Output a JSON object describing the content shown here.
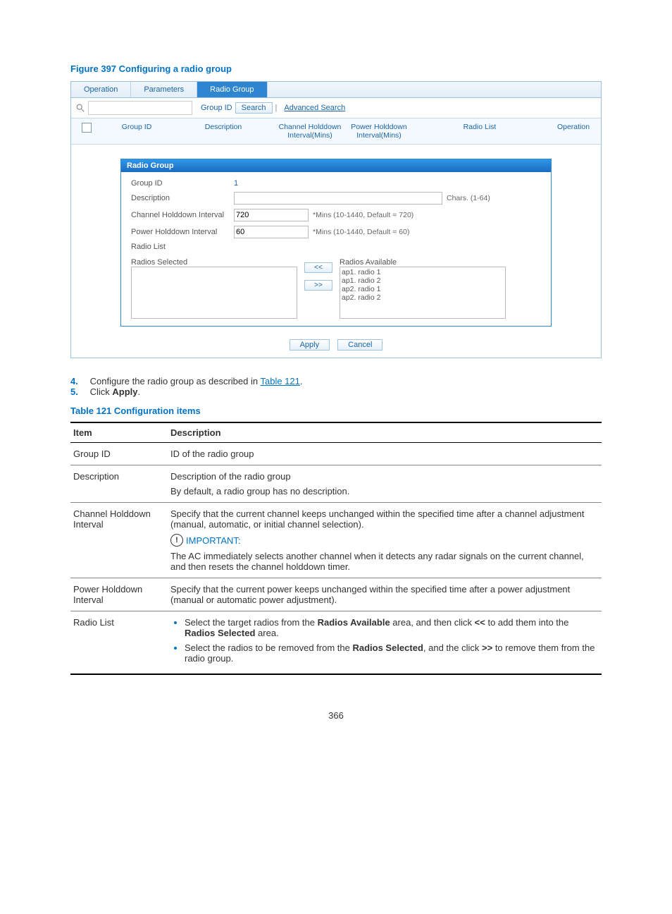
{
  "figure_title": "Figure 397 Configuring a radio group",
  "tabs": {
    "t0": "Operation",
    "t1": "Parameters",
    "t2": "Radio Group"
  },
  "search": {
    "groupid_label": "Group ID",
    "btn": "Search",
    "adv": "Advanced Search"
  },
  "grid": {
    "groupid": "Group ID",
    "description": "Description",
    "chhold": "Channel Holddown Interval(Mins)",
    "pwhold": "Power Holddown Interval(Mins)",
    "radiolist": "Radio List",
    "operation": "Operation"
  },
  "panel": {
    "head": "Radio Group"
  },
  "form": {
    "gid_label": "Group ID",
    "gid_value": "1",
    "desc_label": "Description",
    "desc_note": "Chars. (1-64)",
    "ch_label": "Channel Holddown Interval",
    "ch_value": "720",
    "ch_note": "*Mins (10-1440, Default = 720)",
    "pw_label": "Power Holddown Interval",
    "pw_value": "60",
    "pw_note": "*Mins (10-1440, Default = 60)",
    "rl_label": "Radio List",
    "rsel": "Radios Selected",
    "ravail": "Radios Available",
    "r0": "ap1.  radio 1",
    "r1": "ap1.  radio 2",
    "r2": "ap2.  radio 1",
    "r3": "ap2.  radio 2",
    "add": "<<",
    "remove": ">>",
    "apply": "Apply",
    "cancel": "Cancel"
  },
  "steps": {
    "n4": "4.",
    "s4a": "Configure the radio group as described in ",
    "s4link": "Table 121",
    "s4b": ".",
    "n5": "5.",
    "s5a": "Click ",
    "s5b": "Apply",
    "s5c": "."
  },
  "table_title": "Table 121 Configuration items",
  "thead": {
    "item": "Item",
    "desc": "Description"
  },
  "rows": {
    "r1_item": "Group ID",
    "r1_desc": "ID of the radio group",
    "r2_item": "Description",
    "r2_d1": "Description of the radio group",
    "r2_d2": "By default, a radio group has no description.",
    "r3_item": "Channel Holddown Interval",
    "r3_d1": "Specify that the current channel keeps unchanged within the specified time after a channel adjustment (manual, automatic, or initial channel selection).",
    "r3_imp": "IMPORTANT:",
    "r3_d2": "The AC immediately selects another channel when it detects any radar signals on the current channel, and then resets the channel holddown timer.",
    "r4_item": "Power Holddown Interval",
    "r4_d1": "Specify that the current power keeps unchanged within the specified time after a power adjustment (manual or automatic power adjustment).",
    "r5_item": "Radio List",
    "r5_b1a": "Select the target radios from the ",
    "r5_b1b": "Radios Available",
    "r5_b1c": " area, and then click ",
    "r5_b1d": "<<",
    "r5_b1e": " to add them into the ",
    "r5_b1f": "Radios Selected",
    "r5_b1g": " area.",
    "r5_b2a": "Select the radios to be removed from the ",
    "r5_b2b": "Radios Selected",
    "r5_b2c": ", and the click ",
    "r5_b2d": ">>",
    "r5_b2e": " to remove them from the radio group."
  },
  "pagenum": "366"
}
